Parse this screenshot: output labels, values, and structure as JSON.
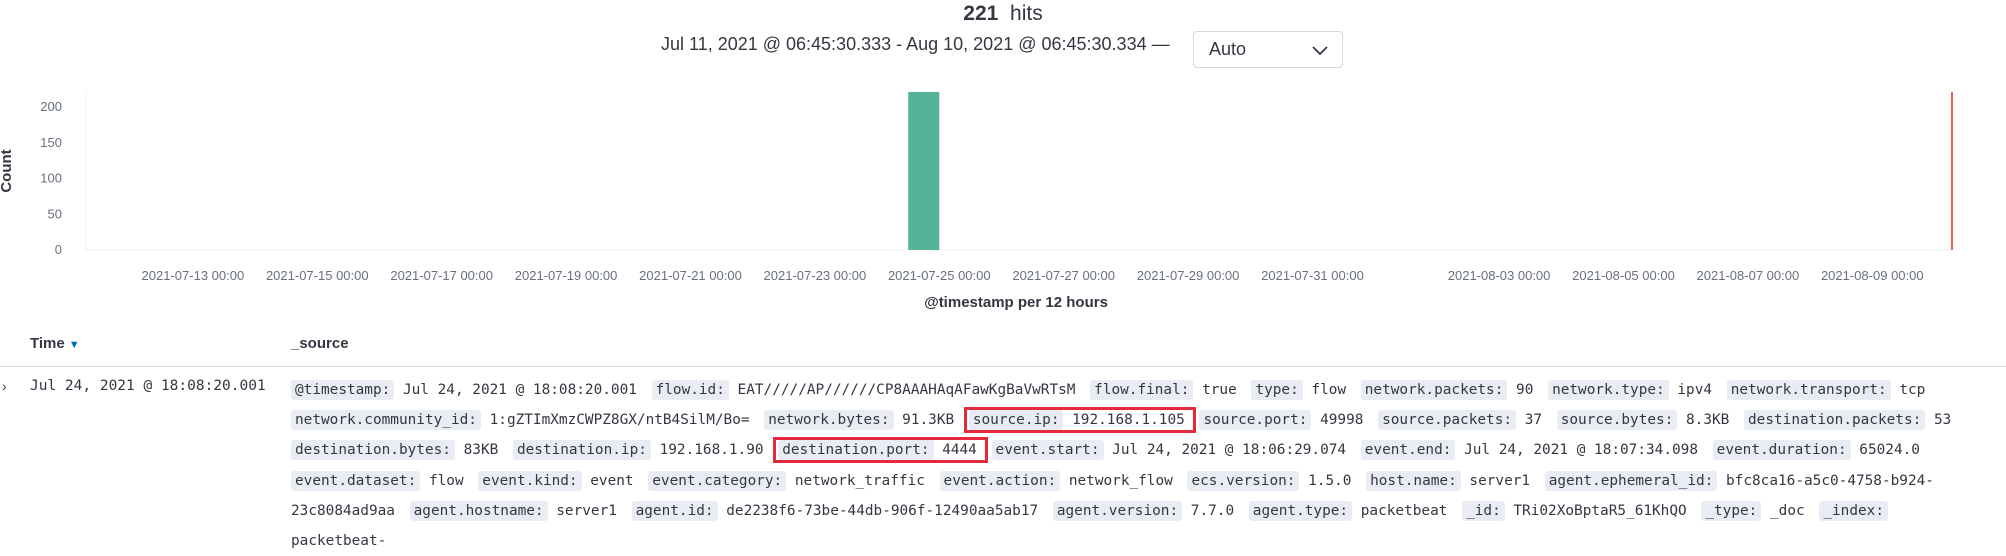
{
  "hits": {
    "count": "221",
    "label": "hits"
  },
  "time_range": {
    "text": "Jul 11, 2021 @ 06:45:30.333 - Aug 10, 2021 @ 06:45:30.334 —"
  },
  "interval": {
    "selected": "Auto"
  },
  "chart_data": {
    "type": "bar",
    "ylabel": "Count",
    "xlabel": "@timestamp per 12 hours",
    "yticks": [
      0,
      50,
      100,
      150,
      200
    ],
    "ylim": [
      0,
      221
    ],
    "xticks": [
      "2021-07-13 00:00",
      "2021-07-15 00:00",
      "2021-07-17 00:00",
      "2021-07-19 00:00",
      "2021-07-21 00:00",
      "2021-07-23 00:00",
      "2021-07-25 00:00",
      "2021-07-27 00:00",
      "2021-07-29 00:00",
      "2021-07-31 00:00",
      "2021-08-03 00:00",
      "2021-08-05 00:00",
      "2021-08-07 00:00",
      "2021-08-09 00:00"
    ],
    "series": [
      {
        "values": [
          {
            "x": "2021-07-24 12:00",
            "y": 221
          }
        ]
      }
    ],
    "bar_color": "#54b399",
    "now_marker_color": "#e7664c"
  },
  "table": {
    "columns": {
      "time": "Time",
      "source": "_source"
    },
    "rows": [
      {
        "time": "Jul 24, 2021 @ 18:08:20.001",
        "fields": [
          {
            "k": "@timestamp:",
            "v": "Jul 24, 2021 @ 18:08:20.001"
          },
          {
            "k": "flow.id:",
            "v": "EAT/////AP//////CP8AAAHAqAFawKgBaVwRTsM"
          },
          {
            "k": "flow.final:",
            "v": "true"
          },
          {
            "k": "type:",
            "v": "flow"
          },
          {
            "k": "network.packets:",
            "v": "90"
          },
          {
            "k": "network.type:",
            "v": "ipv4"
          },
          {
            "k": "network.transport:",
            "v": "tcp"
          },
          {
            "k": "network.community_id:",
            "v": "1:gZTImXmzCWPZ8GX/ntB4SilM/Bo="
          },
          {
            "k": "network.bytes:",
            "v": "91.3KB"
          },
          {
            "k": "source.ip:",
            "v": "192.168.1.105",
            "highlight": true
          },
          {
            "k": "source.port:",
            "v": "49998"
          },
          {
            "k": "source.packets:",
            "v": "37"
          },
          {
            "k": "source.bytes:",
            "v": "8.3KB"
          },
          {
            "k": "destination.packets:",
            "v": "53"
          },
          {
            "k": "destination.bytes:",
            "v": "83KB"
          },
          {
            "k": "destination.ip:",
            "v": "192.168.1.90"
          },
          {
            "k": "destination.port:",
            "v": "4444",
            "highlight": true
          },
          {
            "k": "event.start:",
            "v": "Jul 24, 2021 @ 18:06:29.074"
          },
          {
            "k": "event.end:",
            "v": "Jul 24, 2021 @ 18:07:34.098"
          },
          {
            "k": "event.duration:",
            "v": "65024.0"
          },
          {
            "k": "event.dataset:",
            "v": "flow"
          },
          {
            "k": "event.kind:",
            "v": "event"
          },
          {
            "k": "event.category:",
            "v": "network_traffic"
          },
          {
            "k": "event.action:",
            "v": "network_flow"
          },
          {
            "k": "ecs.version:",
            "v": "1.5.0"
          },
          {
            "k": "host.name:",
            "v": "server1"
          },
          {
            "k": "agent.ephemeral_id:",
            "v": "bfc8ca16-a5c0-4758-b924-23c8084ad9aa"
          },
          {
            "k": "agent.hostname:",
            "v": "server1"
          },
          {
            "k": "agent.id:",
            "v": "de2238f6-73be-44db-906f-12490aa5ab17"
          },
          {
            "k": "agent.version:",
            "v": "7.7.0"
          },
          {
            "k": "agent.type:",
            "v": "packetbeat"
          },
          {
            "k": "_id:",
            "v": "TRi02XoBptaR5_61KhQO"
          },
          {
            "k": "_type:",
            "v": "_doc"
          },
          {
            "k": "_index:",
            "v": "packetbeat-"
          }
        ]
      }
    ]
  }
}
